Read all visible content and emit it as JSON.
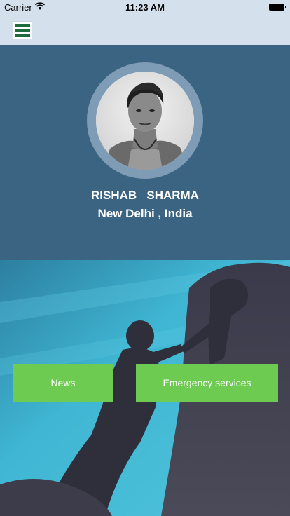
{
  "status_bar": {
    "carrier": "Carrier",
    "time": "11:23 AM"
  },
  "nav": {
    "menu_icon": "hamburger-menu-icon"
  },
  "profile": {
    "name": "RISHAB   SHARMA",
    "location": "New Delhi , India"
  },
  "actions": {
    "news_label": "News",
    "emergency_label": "Emergency services"
  },
  "colors": {
    "header_bg": "#3b6482",
    "button_green": "#6ccb50",
    "nav_bg": "#d4e0eb"
  }
}
